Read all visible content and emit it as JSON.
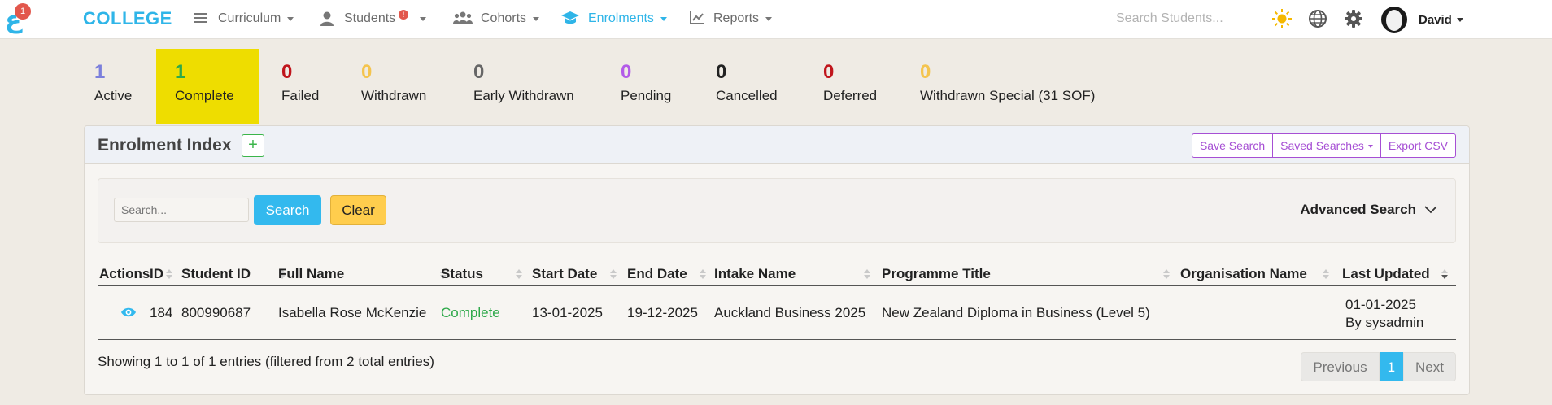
{
  "nav": {
    "logo_badge": "1",
    "brand": "COLLEGE",
    "items": [
      {
        "label": "Curriculum",
        "icon": "list-icon"
      },
      {
        "label": "Students",
        "icon": "user-icon",
        "alert": "!"
      },
      {
        "label": "Cohorts",
        "icon": "users-icon"
      },
      {
        "label": "Enrolments",
        "icon": "graduation-cap-icon",
        "active": true
      },
      {
        "label": "Reports",
        "icon": "line-chart-icon"
      }
    ],
    "search_placeholder": "Search Students...",
    "user_name": "David"
  },
  "stats": [
    {
      "count": "1",
      "label": "Active",
      "color": "#7b7fdc"
    },
    {
      "count": "1",
      "label": "Complete",
      "color": "#2ea94a",
      "highlight": true
    },
    {
      "count": "0",
      "label": "Failed",
      "color": "#c0151c"
    },
    {
      "count": "0",
      "label": "Withdrawn",
      "color": "#f4c44e"
    },
    {
      "count": "0",
      "label": "Early Withdrawn",
      "color": "#666666"
    },
    {
      "count": "0",
      "label": "Pending",
      "color": "#b35be8"
    },
    {
      "count": "0",
      "label": "Cancelled",
      "color": "#222222"
    },
    {
      "count": "0",
      "label": "Deferred",
      "color": "#c0151c"
    },
    {
      "count": "0",
      "label": "Withdrawn Special (31 SOF)",
      "color": "#f4c44e"
    }
  ],
  "card": {
    "title": "Enrolment Index",
    "add_label": "+",
    "actions": {
      "save_search": "Save Search",
      "saved_searches": "Saved Searches",
      "export_csv": "Export CSV"
    }
  },
  "filter": {
    "placeholder": "Search...",
    "search_label": "Search",
    "clear_label": "Clear",
    "advanced_label": "Advanced Search"
  },
  "table": {
    "columns": [
      "Actions",
      "ID",
      "Student ID",
      "Full Name",
      "Status",
      "Start Date",
      "End Date",
      "Intake Name",
      "Programme Title",
      "Organisation Name",
      "Last Updated"
    ],
    "rows": [
      {
        "id": "184",
        "student_id": "800990687",
        "full_name": "Isabella Rose McKenzie",
        "status": "Complete",
        "start_date": "13-01-2025",
        "end_date": "19-12-2025",
        "intake_name": "Auckland Business 2025",
        "programme_title": "New Zealand Diploma in Business (Level 5)",
        "organisation_name": "",
        "last_updated_date": "01-01-2025",
        "last_updated_by": "By sysadmin"
      }
    ]
  },
  "footer": {
    "info": "Showing 1 to 1 of 1 entries (filtered from 2 total entries)",
    "prev": "Previous",
    "current": "1",
    "next": "Next"
  }
}
